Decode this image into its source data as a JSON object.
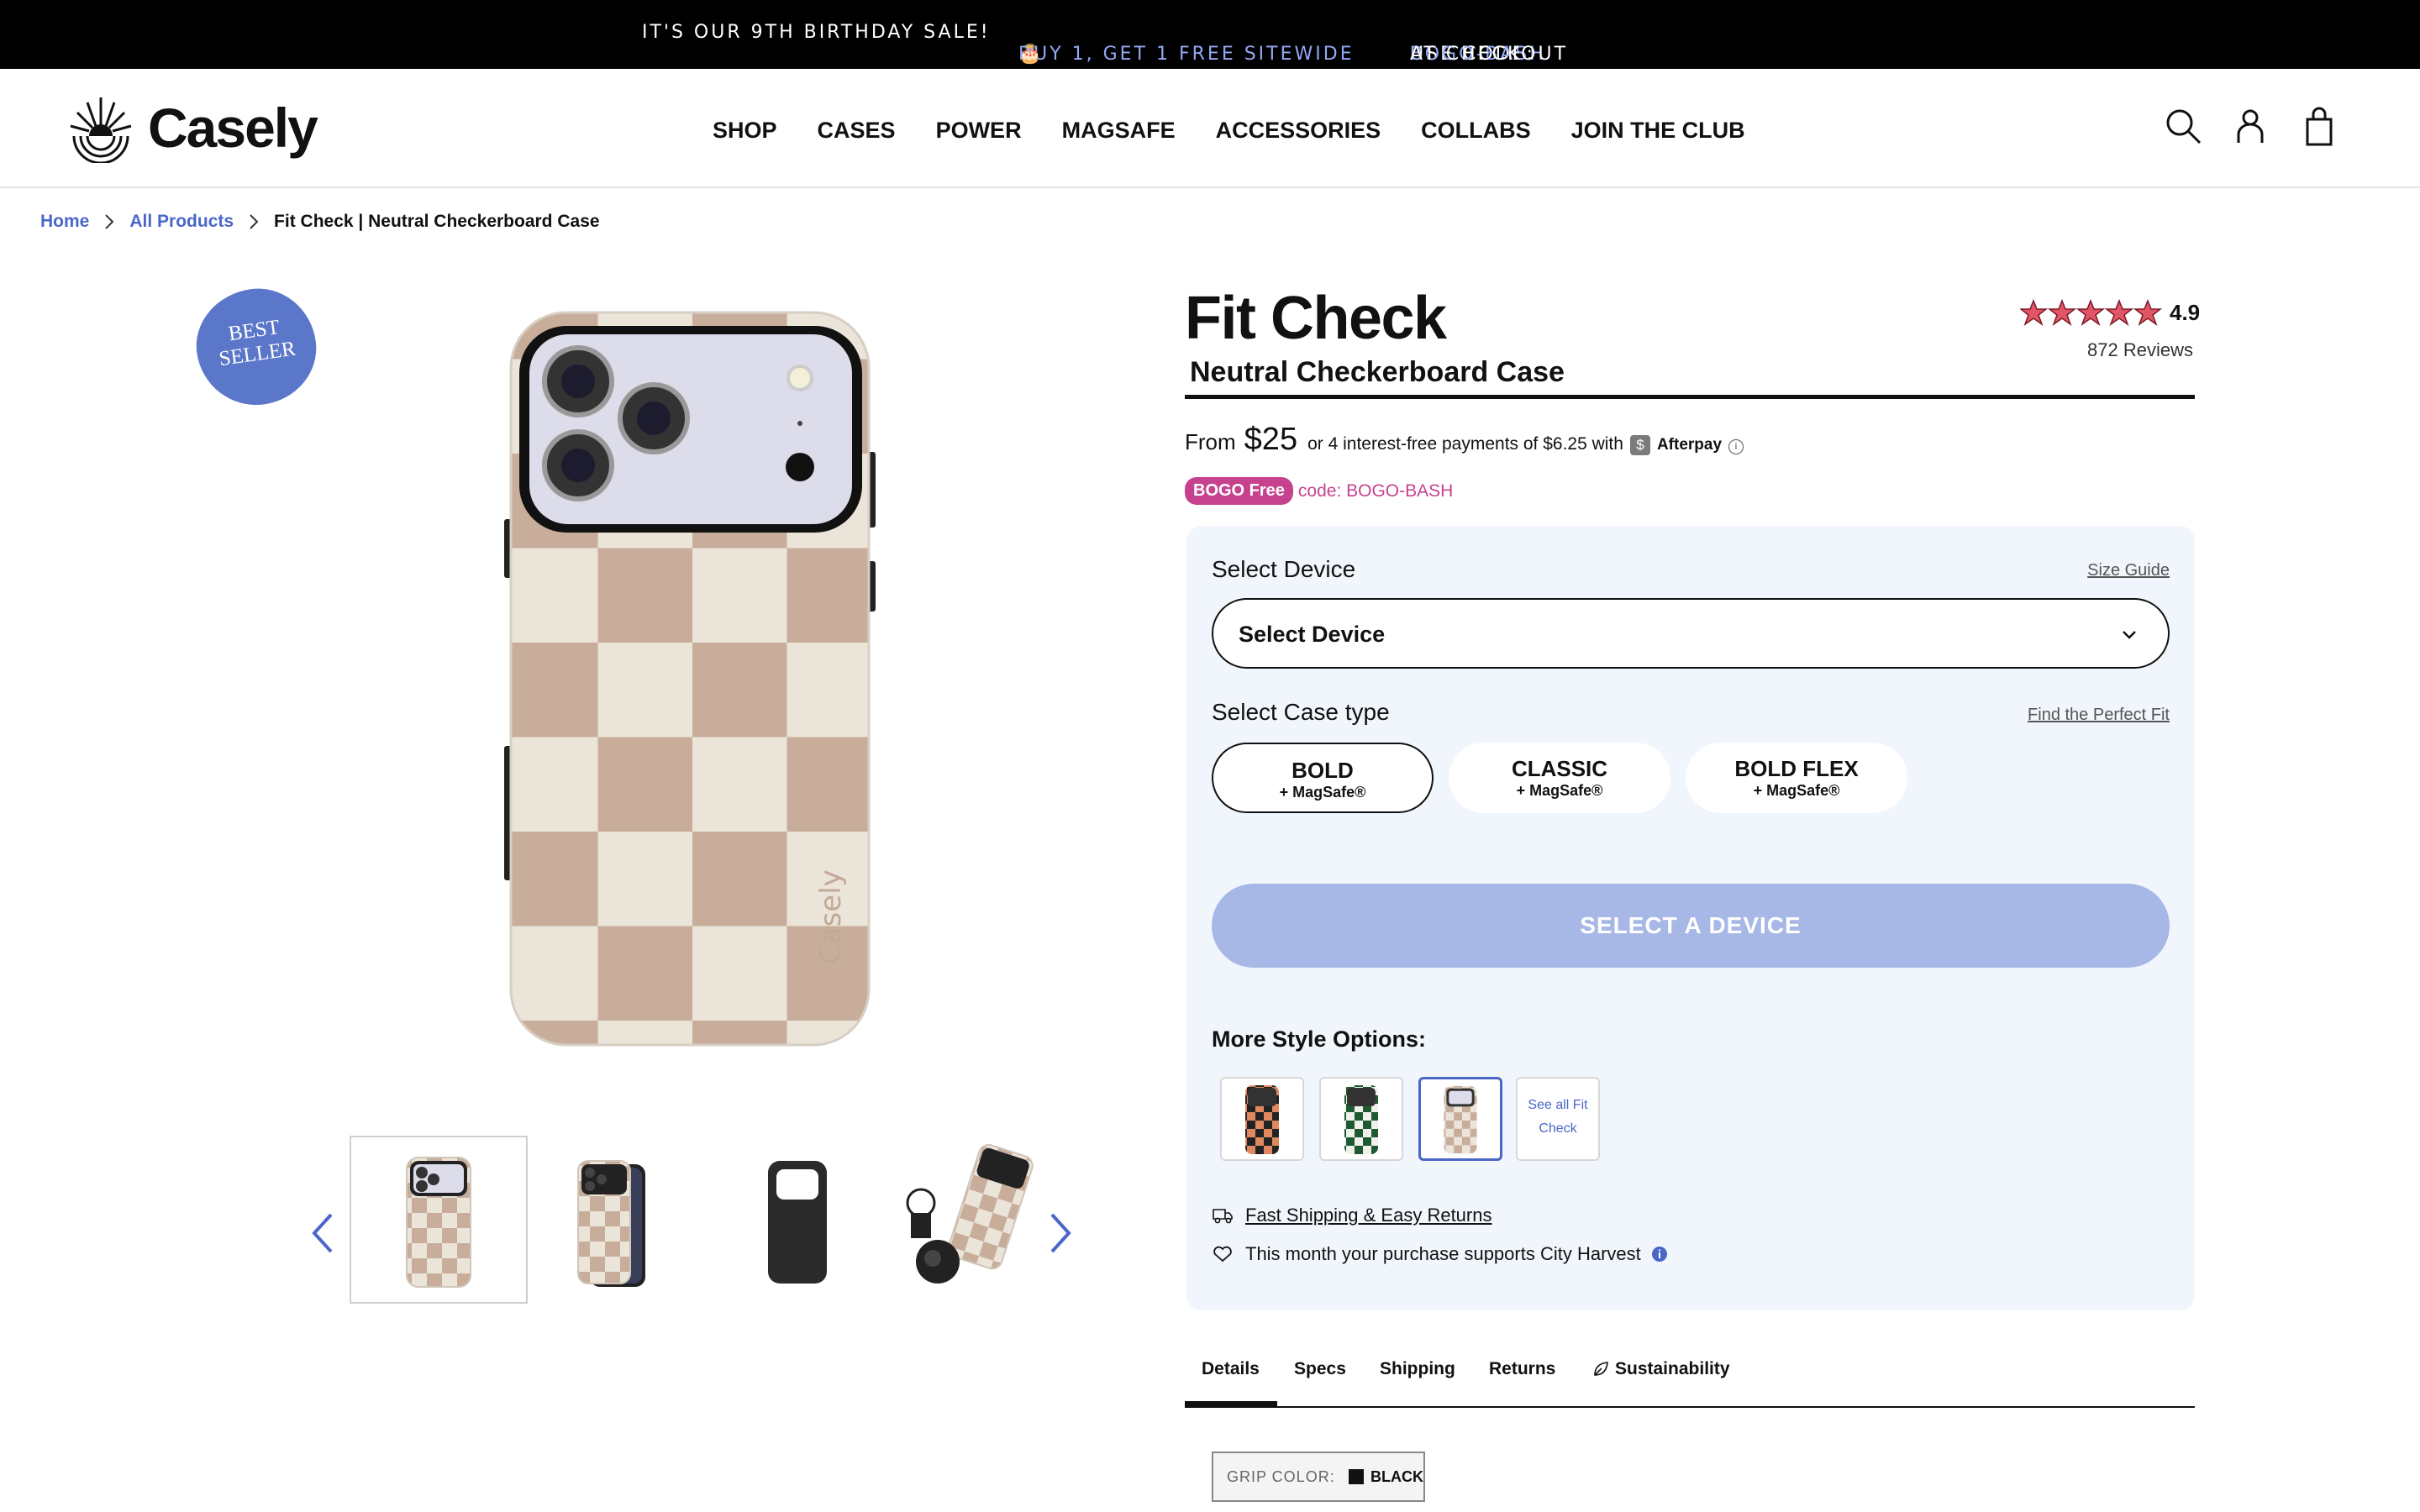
{
  "promo": {
    "left": "IT'S OUR 9TH BIRTHDAY SALE!",
    "middle": "BUY 1, GET 1 FREE SITEWIDE",
    "right_prefix": "USE CODE:",
    "right_code": "BOGO-BASH",
    "right_suffix": "AT CHECKOUT",
    "accent_color": "#93a8f4"
  },
  "header": {
    "logo": "Casely",
    "nav": [
      "SHOP",
      "CASES",
      "POWER",
      "MAGSAFE",
      "ACCESSORIES",
      "COLLABS",
      "JOIN THE CLUB"
    ],
    "icons": [
      "search-icon",
      "account-icon",
      "cart-icon"
    ]
  },
  "breadcrumb": {
    "home": "Home",
    "all": "All Products",
    "current": "Fit Check | Neutral Checkerboard Case"
  },
  "gallery": {
    "badge_line1": "BEST",
    "badge_line2": "SELLER",
    "thumbnails": [
      "front-view",
      "angled-view",
      "back-shell",
      "magsafe-accessories"
    ],
    "active_thumbnail": 0
  },
  "product": {
    "title": "Fit Check",
    "subtitle": "Neutral Checkerboard Case",
    "rating": "4.9",
    "stars": 5,
    "reviews": "872 Reviews",
    "price_from": "From",
    "price": "$25",
    "installments": "or 4 interest-free payments of $6.25 with",
    "afterpay_mark": "$",
    "afterpay": "Afterpay",
    "promo_pill": "BOGO Free",
    "promo_code": "code: BOGO-BASH",
    "promo_color": "#c6428f"
  },
  "options": {
    "device_label": "Select Device",
    "size_guide": "Size Guide",
    "device_value": "Select Device",
    "case_label": "Select Case type",
    "find_fit": "Find the Perfect Fit",
    "case_types": [
      {
        "name": "BOLD",
        "sub": "+ MagSafe®"
      },
      {
        "name": "CLASSIC",
        "sub": "+ MagSafe®"
      },
      {
        "name": "BOLD FLEX",
        "sub": "+ MagSafe®"
      }
    ],
    "selected_case": 0,
    "cta": "SELECT A DEVICE",
    "more_styles": "More Style Options:",
    "swatches": [
      "orange-black-checker",
      "green-white-checker",
      "neutral-checker"
    ],
    "selected_swatch": 2,
    "see_all": "See all Fit Check",
    "shipping": "Fast Shipping & Easy Returns",
    "charity": "This month your purchase supports City Harvest"
  },
  "tabs": {
    "items": [
      "Details",
      "Specs",
      "Shipping",
      "Returns",
      "Sustainability"
    ],
    "active": 0
  },
  "grip": {
    "label": "GRIP COLOR:",
    "value": "BLACK"
  }
}
